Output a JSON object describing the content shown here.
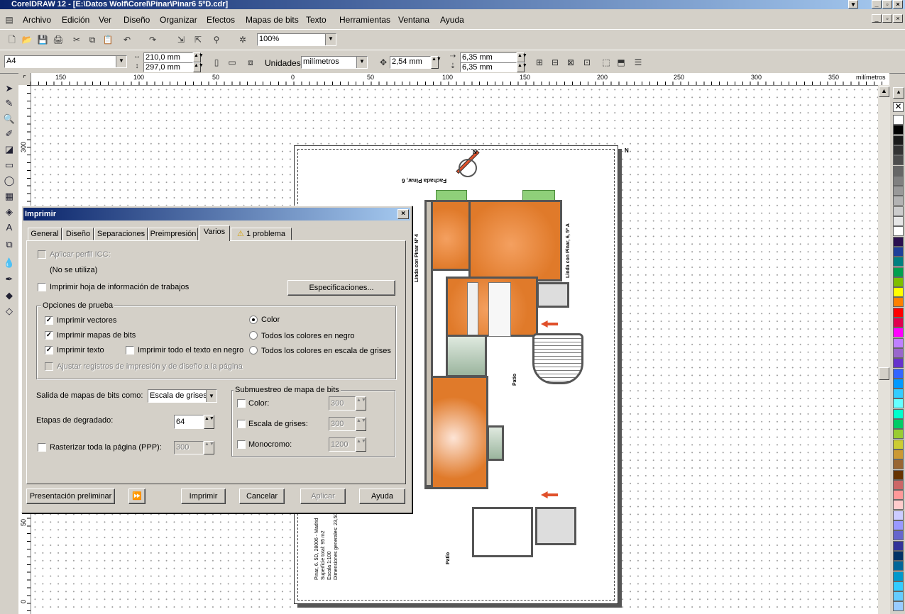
{
  "window": {
    "title": "CorelDRAW 12 - [E:\\Datos Wolf\\Corel\\Pinar\\Pinar6 5ºD.cdr]",
    "min": "_",
    "max": "▫",
    "close": "×"
  },
  "menu": [
    "Archivo",
    "Edición",
    "Ver",
    "Diseño",
    "Organizar",
    "Efectos",
    "Mapas de bits",
    "Texto",
    "Herramientas",
    "Ventana",
    "Ayuda"
  ],
  "standard_toolbar": {
    "zoom": "100%"
  },
  "property_bar": {
    "page_size": "A4",
    "width": "210,0 mm",
    "height": "297,0 mm",
    "units_label": "Unidades:",
    "units": "milímetros",
    "nudge": "2,54 mm",
    "dup_x": "6,35 mm",
    "dup_y": "6,35 mm"
  },
  "ruler": {
    "h_labels": [
      "150",
      "100",
      "50",
      "0",
      "50",
      "100",
      "150",
      "200",
      "250",
      "300",
      "350"
    ],
    "unit": "milímetros",
    "v_labels": [
      "300",
      "50",
      "0"
    ]
  },
  "drawing": {
    "north": "N",
    "facade": "Fachada Pinar, 6",
    "left_label": "Linda con Pinar Nº 4",
    "right_label": "Linda con Pinar, 6, 5º A",
    "patio1": "Patio",
    "patio2": "Patio",
    "notes": [
      "Pinar, 6. 5D, 28006 - Madrid",
      "Superficie total: 95 m2",
      "Escala 1:100",
      "Dimensiones generales: 23,50 m"
    ]
  },
  "dialog": {
    "title": "Imprimir",
    "close": "×",
    "tabs": [
      "General",
      "Diseño",
      "Separaciones",
      "Preimpresión",
      "Varios",
      "1 problema"
    ],
    "active_tab": "Varios",
    "icc_label": "Aplicar perfil ICC:",
    "icc_value": "(No se utiliza)",
    "job_info": "Imprimir hoja de información de trabajos",
    "specs_button": "Especificaciones...",
    "proof_group": "Opciones de prueba",
    "print_vectors": "Imprimir vectores",
    "print_bitmaps": "Imprimir mapas de bits",
    "print_text": "Imprimir texto",
    "print_all_black": "Imprimir todo el texto en negro",
    "fit_marks": "Ajustar registros de impresión y de diseño a la página",
    "color": "Color",
    "all_black": "Todos los colores en negro",
    "all_gray": "Todos los colores en escala de grises",
    "bitmap_out_label": "Salida de mapas de bits como:",
    "bitmap_out_value": "Escala de grises",
    "fountain_label": "Etapas de degradado:",
    "fountain_value": "64",
    "rasterize_label": "Rasterizar toda la página (PPP):",
    "rasterize_value": "300",
    "downsample_group": "Submuestreo de mapa de bits",
    "ds_color": "Color:",
    "ds_color_val": "300",
    "ds_gray": "Escala de grises:",
    "ds_gray_val": "300",
    "ds_mono": "Monocromo:",
    "ds_mono_val": "1200",
    "btn_preview": "Presentación preliminar",
    "btn_print": "Imprimir",
    "btn_cancel": "Cancelar",
    "btn_apply": "Aplicar",
    "btn_help": "Ayuda"
  },
  "palette_colors": [
    "#ffffff",
    "#000000",
    "#1a1a1a",
    "#333333",
    "#4d4d4d",
    "#666666",
    "#808080",
    "#999999",
    "#b3b3b3",
    "#cccccc",
    "#e6e6e6",
    "#ffffff",
    "#2b0f4f",
    "#1f3f99",
    "#008080",
    "#00a04f",
    "#7fbf00",
    "#ffff00",
    "#ff8000",
    "#ff0000",
    "#e0004f",
    "#ff00ff",
    "#bf80ff",
    "#9966cc",
    "#6633cc",
    "#3366ff",
    "#0099ff",
    "#33ccff",
    "#66ffff",
    "#00ffcc",
    "#00cc66",
    "#99cc33",
    "#cccc33",
    "#cc9933",
    "#996633",
    "#663300",
    "#cc6666",
    "#ff9999",
    "#ffcccc",
    "#ccccff",
    "#9999ff",
    "#6666cc",
    "#333399",
    "#003366",
    "#006699",
    "#0099cc",
    "#33ccff",
    "#66ccff",
    "#99ccff",
    "#669999",
    "#336666"
  ]
}
